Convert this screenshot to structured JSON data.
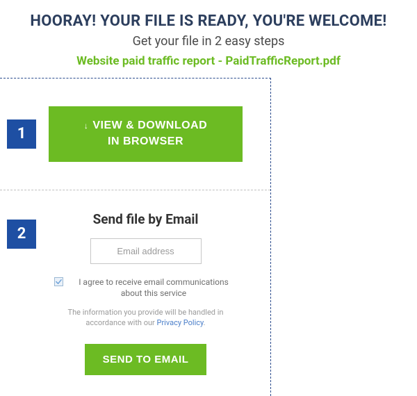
{
  "header": {
    "title": "HOORAY! YOUR FILE IS READY, YOU'RE WELCOME!",
    "subtitle": "Get your file in 2 easy steps",
    "filename": "Website paid traffic report - PaidTrafficReport.pdf"
  },
  "step1": {
    "number": "1",
    "button_line1": "VIEW & DOWNLOAD",
    "button_line2": "IN BROWSER"
  },
  "step2": {
    "number": "2",
    "title": "Send file by Email",
    "email_placeholder": "Email address",
    "email_value": "",
    "agree_text": "I agree to receive email communications about this service",
    "agree_checked": true,
    "privacy_prefix": "The information you provide will be handled in accordance with our ",
    "privacy_link_text": "Privacy Policy",
    "privacy_suffix": ".",
    "send_button": "SEND TO EMAIL"
  }
}
